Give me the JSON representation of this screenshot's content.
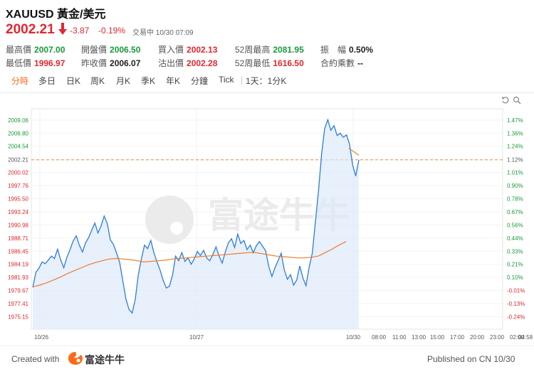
{
  "header": {
    "title": "XAUUSD 黃金/美元",
    "price": "2002.21",
    "change": "-3.87",
    "change_pct": "-0.19%",
    "status": "交易中  10/30 07:09"
  },
  "stats": [
    {
      "label": "最高價",
      "value": "2007.00",
      "color": "#1a9a3a"
    },
    {
      "label": "開盤價",
      "value": "2006.50",
      "color": "#1a9a3a"
    },
    {
      "label": "買入價",
      "value": "2002.13",
      "color": "#e0282f"
    },
    {
      "label": "52周最高",
      "value": "2081.95",
      "color": "#1a9a3a"
    },
    {
      "label": "振　幅",
      "value": "0.50%",
      "color": "#222222"
    },
    {
      "label": "最低價",
      "value": "1996.97",
      "color": "#e0282f"
    },
    {
      "label": "昨收價",
      "value": "2006.07",
      "color": "#222222"
    },
    {
      "label": "沽出價",
      "value": "2002.28",
      "color": "#e0282f"
    },
    {
      "label": "52周最低",
      "value": "1616.50",
      "color": "#e0282f"
    },
    {
      "label": "合約乘數",
      "value": "--",
      "color": "#222222"
    }
  ],
  "tabs": [
    "分時",
    "多日",
    "日K",
    "周K",
    "月K",
    "季K",
    "年K",
    "分鐘",
    "Tick",
    "1天：1分K"
  ],
  "active_tab": "分時",
  "chart_data": {
    "type": "line",
    "y_ticks": [
      "2009.06",
      "2006.80",
      "2004.54",
      "2002.21",
      "2000.02",
      "1997.76",
      "1995.50",
      "1993.24",
      "1990.98",
      "1988.71",
      "1986.45",
      "1984.19",
      "1981.93",
      "1979.67",
      "1977.41",
      "1975.15"
    ],
    "pct_ticks": [
      "1.47%",
      "1.36%",
      "1.24%",
      "1.12%",
      "1.01%",
      "0.90%",
      "0.78%",
      "0.67%",
      "0.56%",
      "0.44%",
      "0.33%",
      "0.21%",
      "0.10%",
      "-0.01%",
      "-0.13%",
      "-0.24%"
    ],
    "x_labels": [
      "10/26",
      "10/27",
      "10/30",
      "08:00",
      "11:00",
      "13:00",
      "15:00",
      "17:00",
      "20:00",
      "23:00",
      "02:00",
      "04:58"
    ],
    "ylim": [
      1973.0,
      2011.0
    ],
    "reference_price": 2002.21,
    "price_series": [
      1980.2,
      1982.8,
      1983.5,
      1984.6,
      1984.3,
      1984.9,
      1985.6,
      1985.2,
      1986.8,
      1984.9,
      1983.6,
      1985.4,
      1986.7,
      1988.2,
      1989.1,
      1987.5,
      1986.3,
      1987.9,
      1988.8,
      1990.1,
      1991.3,
      1989.6,
      1990.8,
      1992.5,
      1991.2,
      1988.4,
      1987.6,
      1986.1,
      1984.5,
      1981.3,
      1978.2,
      1976.4,
      1975.8,
      1978.1,
      1982.4,
      1985.2,
      1987.5,
      1986.9,
      1988.3,
      1986.2,
      1984.6,
      1983.2,
      1981.4,
      1980.1,
      1980.4,
      1982.3,
      1985.6,
      1984.8,
      1986.2,
      1984.7,
      1985.3,
      1984.2,
      1985.1,
      1986.4,
      1985.7,
      1986.6,
      1985.3,
      1984.8,
      1985.9,
      1987.2,
      1985.6,
      1984.4,
      1986.3,
      1987.9,
      1988.6,
      1987.1,
      1989.4,
      1987.8,
      1988.3,
      1986.7,
      1987.5,
      1986.2,
      1987.4,
      1988.1,
      1987.3,
      1986.5,
      1983.8,
      1982.1,
      1983.6,
      1984.8,
      1986.1,
      1983.2,
      1981.6,
      1982.4,
      1980.6,
      1981.5,
      1983.9,
      1981.8,
      1980.5,
      1983.7,
      1986.1,
      1991.4,
      1996.8,
      2003.2,
      2007.6,
      2009.1,
      2007.3,
      2008.1,
      2006.4,
      2006.8,
      2006.1,
      2006.5,
      2004.9,
      2001.3,
      1999.4,
      2002.21
    ],
    "average_series": [
      1980.3,
      1980.6,
      1981.0,
      1981.5,
      1982.0,
      1982.6,
      1983.1,
      1983.6,
      1984.1,
      1984.5,
      1984.8,
      1985.1,
      1985.2,
      1985.1,
      1985.0,
      1984.8,
      1984.6,
      1984.7,
      1984.8,
      1984.9,
      1985.1,
      1985.2,
      1985.3,
      1985.4,
      1985.5,
      1985.6,
      1985.7,
      1985.8,
      1985.9,
      1986.0,
      1986.1,
      1986.2,
      1986.2,
      1986.0,
      1985.8,
      1985.6,
      1985.5,
      1985.4,
      1985.3,
      1985.3,
      1985.4,
      1985.6,
      1986.2,
      1986.8,
      1987.5,
      1988.1
    ],
    "gain_series": [
      2004.2,
      2003.6,
      2003.0
    ]
  },
  "watermark": "富途牛牛",
  "footer": {
    "created_with": "Created with",
    "logo_text": "富途牛牛",
    "published": "Published on CN 10/30"
  }
}
